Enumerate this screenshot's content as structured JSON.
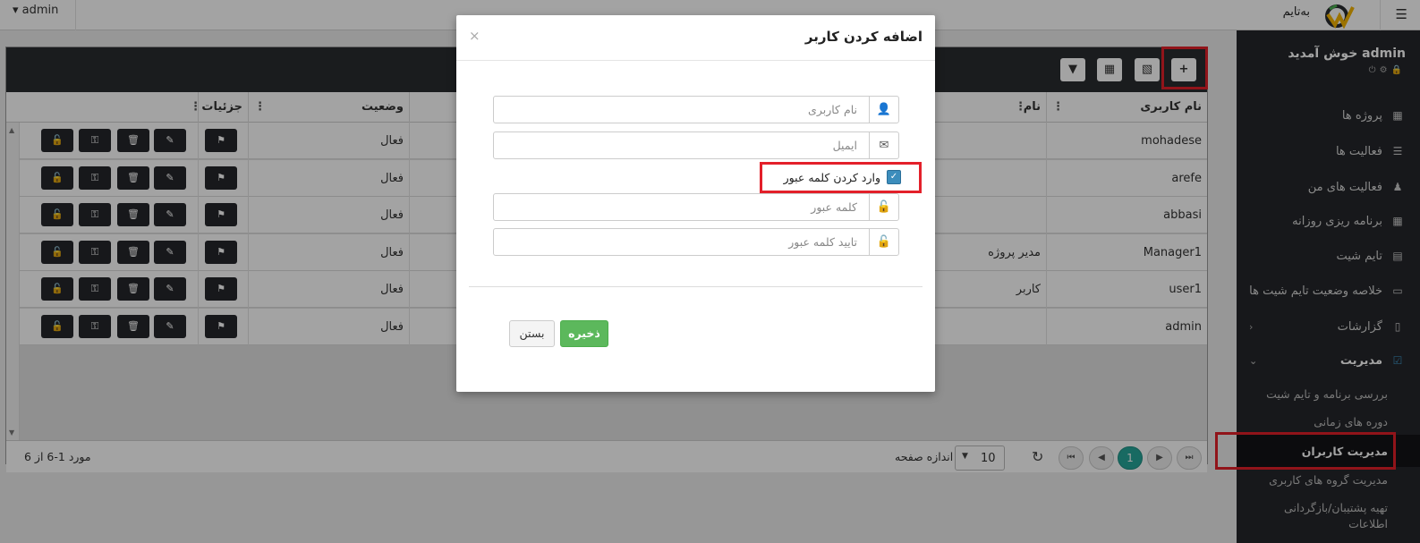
{
  "topbar": {
    "user": "admin",
    "user_caret": "▾",
    "logo_text": "به‌تایم",
    "menu_icon": "☰"
  },
  "sidebar": {
    "welcome": "admin خوش آمدید",
    "items": [
      {
        "label": "پروژه ها",
        "icon": "briefcase-icon"
      },
      {
        "label": "فعالیت ها",
        "icon": "list-icon"
      },
      {
        "label": "فعالیت های من",
        "icon": "user-activity-icon"
      },
      {
        "label": "برنامه ریزی روزانه",
        "icon": "table-icon"
      },
      {
        "label": "تایم شیت",
        "icon": "calendar-icon"
      },
      {
        "label": "خلاصه وضعیت تایم شیت ها",
        "icon": "summary-icon"
      },
      {
        "label": "گزارشات",
        "icon": "file-icon"
      },
      {
        "label": "مدیریت",
        "icon": "check-square-icon"
      }
    ],
    "sub_items": [
      {
        "label": "بررسی برنامه و تایم شیت"
      },
      {
        "label": "دوره های زمانی"
      },
      {
        "label": "مدیریت کاربران"
      },
      {
        "label": "مدیریت گروه های کاربری"
      },
      {
        "label": "تهیه پشتیبان/بازگردانی اطلاعات"
      }
    ],
    "accent": "#3c8dbc"
  },
  "grid": {
    "columns": [
      "نام کاربری",
      "نام",
      "وضعیت",
      "جزئیات"
    ],
    "rows": [
      {
        "username": "mohadese",
        "name": "",
        "status": "فعال"
      },
      {
        "username": "arefe",
        "name": "",
        "status": "فعال"
      },
      {
        "username": "abbasi",
        "name": "",
        "status": "فعال"
      },
      {
        "username": "Manager1",
        "name": "مدیر پروژه",
        "status": "فعال"
      },
      {
        "username": "user1",
        "name": "کاربر",
        "status": "فعال"
      },
      {
        "username": "admin",
        "name": "",
        "status": "فعال"
      }
    ],
    "pager": {
      "count_text": "مورد 1-6 از 6",
      "page_size": "10",
      "page_size_label": "اندازه صفحه",
      "current_page": "1"
    }
  },
  "modal": {
    "title": "اضافه کردن کاربر",
    "close": "×",
    "username_placeholder": "نام کاربری",
    "email_placeholder": "ایمیل",
    "set_password_label": "وارد کردن کلمه عبور",
    "password_placeholder": "کلمه عبور",
    "confirm_password_placeholder": "تایید کلمه عبور",
    "save_label": "ذخیره",
    "close_label": "بستن"
  },
  "colors": {
    "highlight": "#e3202a",
    "save": "#5cb85c",
    "pager_active": "#26a69a"
  }
}
